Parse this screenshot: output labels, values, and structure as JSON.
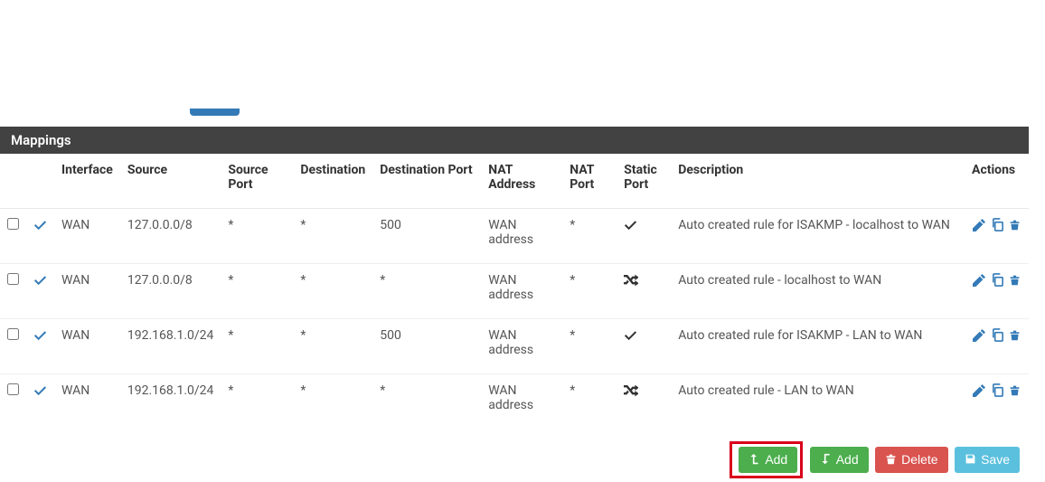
{
  "panel": {
    "title": "Mappings"
  },
  "columns": {
    "interface": "Interface",
    "source": "Source",
    "source_port": "Source Port",
    "destination": "Destination",
    "destination_port": "Destination Port",
    "nat_address": "NAT Address",
    "nat_port": "NAT Port",
    "static_port": "Static Port",
    "description": "Description",
    "actions": "Actions"
  },
  "rows": [
    {
      "interface": "WAN",
      "source": "127.0.0.0/8",
      "source_port": "*",
      "destination": "*",
      "destination_port": "500",
      "nat_address": "WAN address",
      "nat_port": "*",
      "static_port": "check",
      "description": "Auto created rule for ISAKMP - localhost to WAN"
    },
    {
      "interface": "WAN",
      "source": "127.0.0.0/8",
      "source_port": "*",
      "destination": "*",
      "destination_port": "*",
      "nat_address": "WAN address",
      "nat_port": "*",
      "static_port": "shuffle",
      "description": "Auto created rule - localhost to WAN"
    },
    {
      "interface": "WAN",
      "source": "192.168.1.0/24",
      "source_port": "*",
      "destination": "*",
      "destination_port": "500",
      "nat_address": "WAN address",
      "nat_port": "*",
      "static_port": "check",
      "description": "Auto created rule for ISAKMP - LAN to WAN"
    },
    {
      "interface": "WAN",
      "source": "192.168.1.0/24",
      "source_port": "*",
      "destination": "*",
      "destination_port": "*",
      "nat_address": "WAN address",
      "nat_port": "*",
      "static_port": "shuffle",
      "description": "Auto created rule - LAN to WAN"
    }
  ],
  "buttons": {
    "add_top": "Add",
    "add_bottom": "Add",
    "delete": "Delete",
    "save": "Save"
  }
}
